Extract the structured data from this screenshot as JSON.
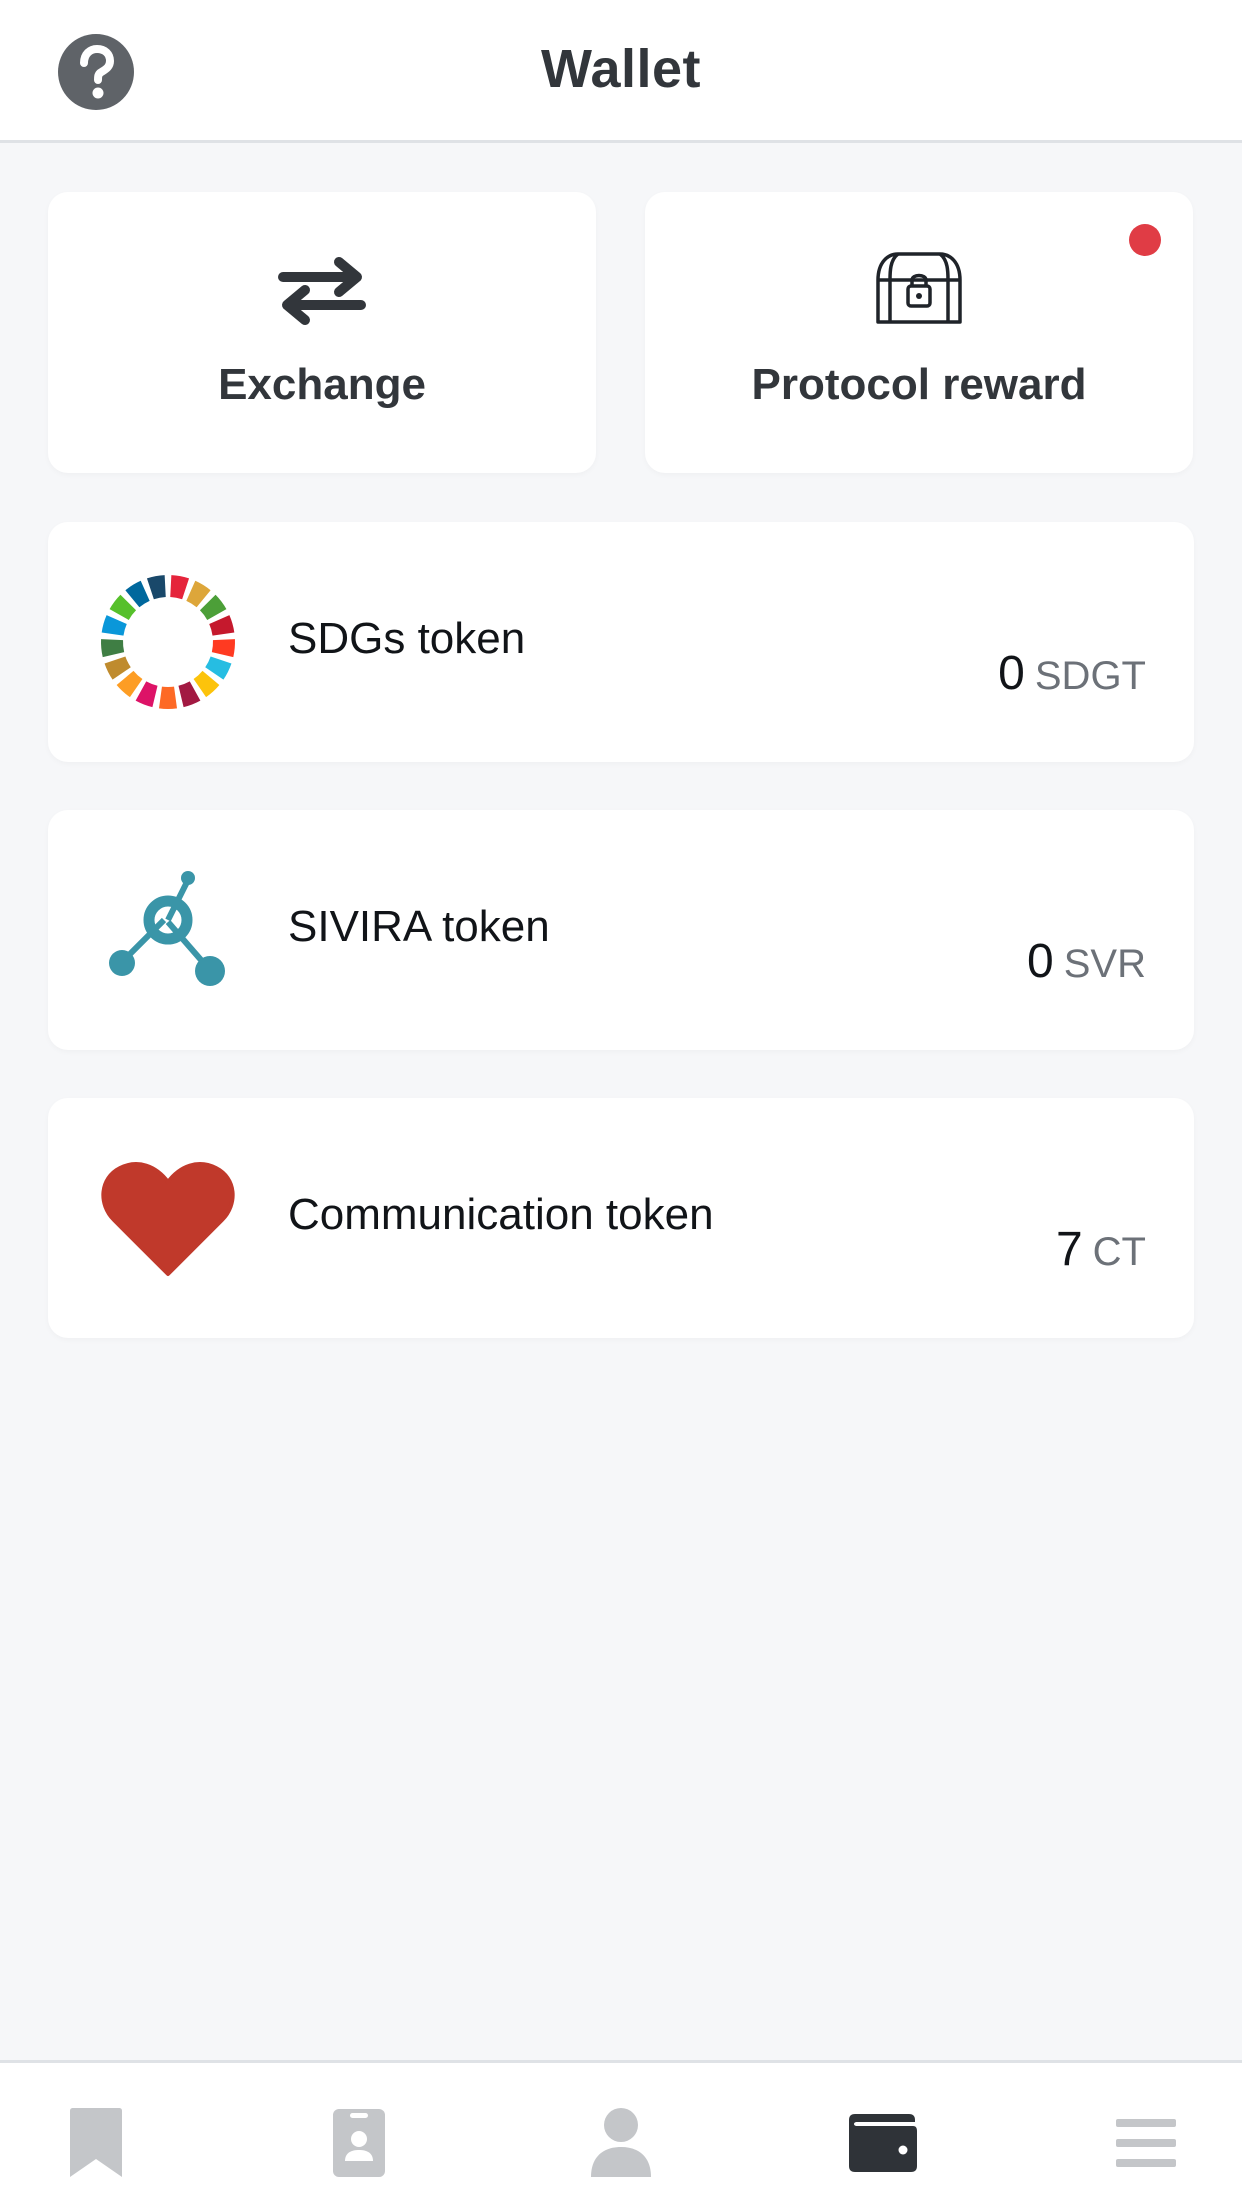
{
  "header": {
    "title": "Wallet",
    "help_icon": "question-circle-icon"
  },
  "actions": [
    {
      "label": "Exchange",
      "icon": "exchange-arrows-icon",
      "has_notification": false
    },
    {
      "label": "Protocol reward",
      "icon": "treasure-chest-icon",
      "has_notification": true,
      "notification_color": "#e03c45"
    }
  ],
  "tokens": [
    {
      "name": "SDGs token",
      "amount": "0",
      "unit": "SDGT",
      "icon": "sdgs-wheel-icon"
    },
    {
      "name": "SIVIRA token",
      "amount": "0",
      "unit": "SVR",
      "icon": "sivira-molecule-icon"
    },
    {
      "name": "Communication token",
      "amount": "7",
      "unit": "CT",
      "icon": "heart-icon"
    }
  ],
  "bottom_nav": [
    {
      "icon": "bookmark-icon",
      "active": false
    },
    {
      "icon": "id-card-icon",
      "active": false
    },
    {
      "icon": "user-icon",
      "active": false
    },
    {
      "icon": "wallet-icon",
      "active": true
    },
    {
      "icon": "menu-icon",
      "active": false
    }
  ],
  "colors": {
    "accent_dark": "#2f3338",
    "inactive_icon": "#c4c6c9",
    "sivira_teal": "#3a95a8",
    "heart_red": "#c0392b"
  }
}
